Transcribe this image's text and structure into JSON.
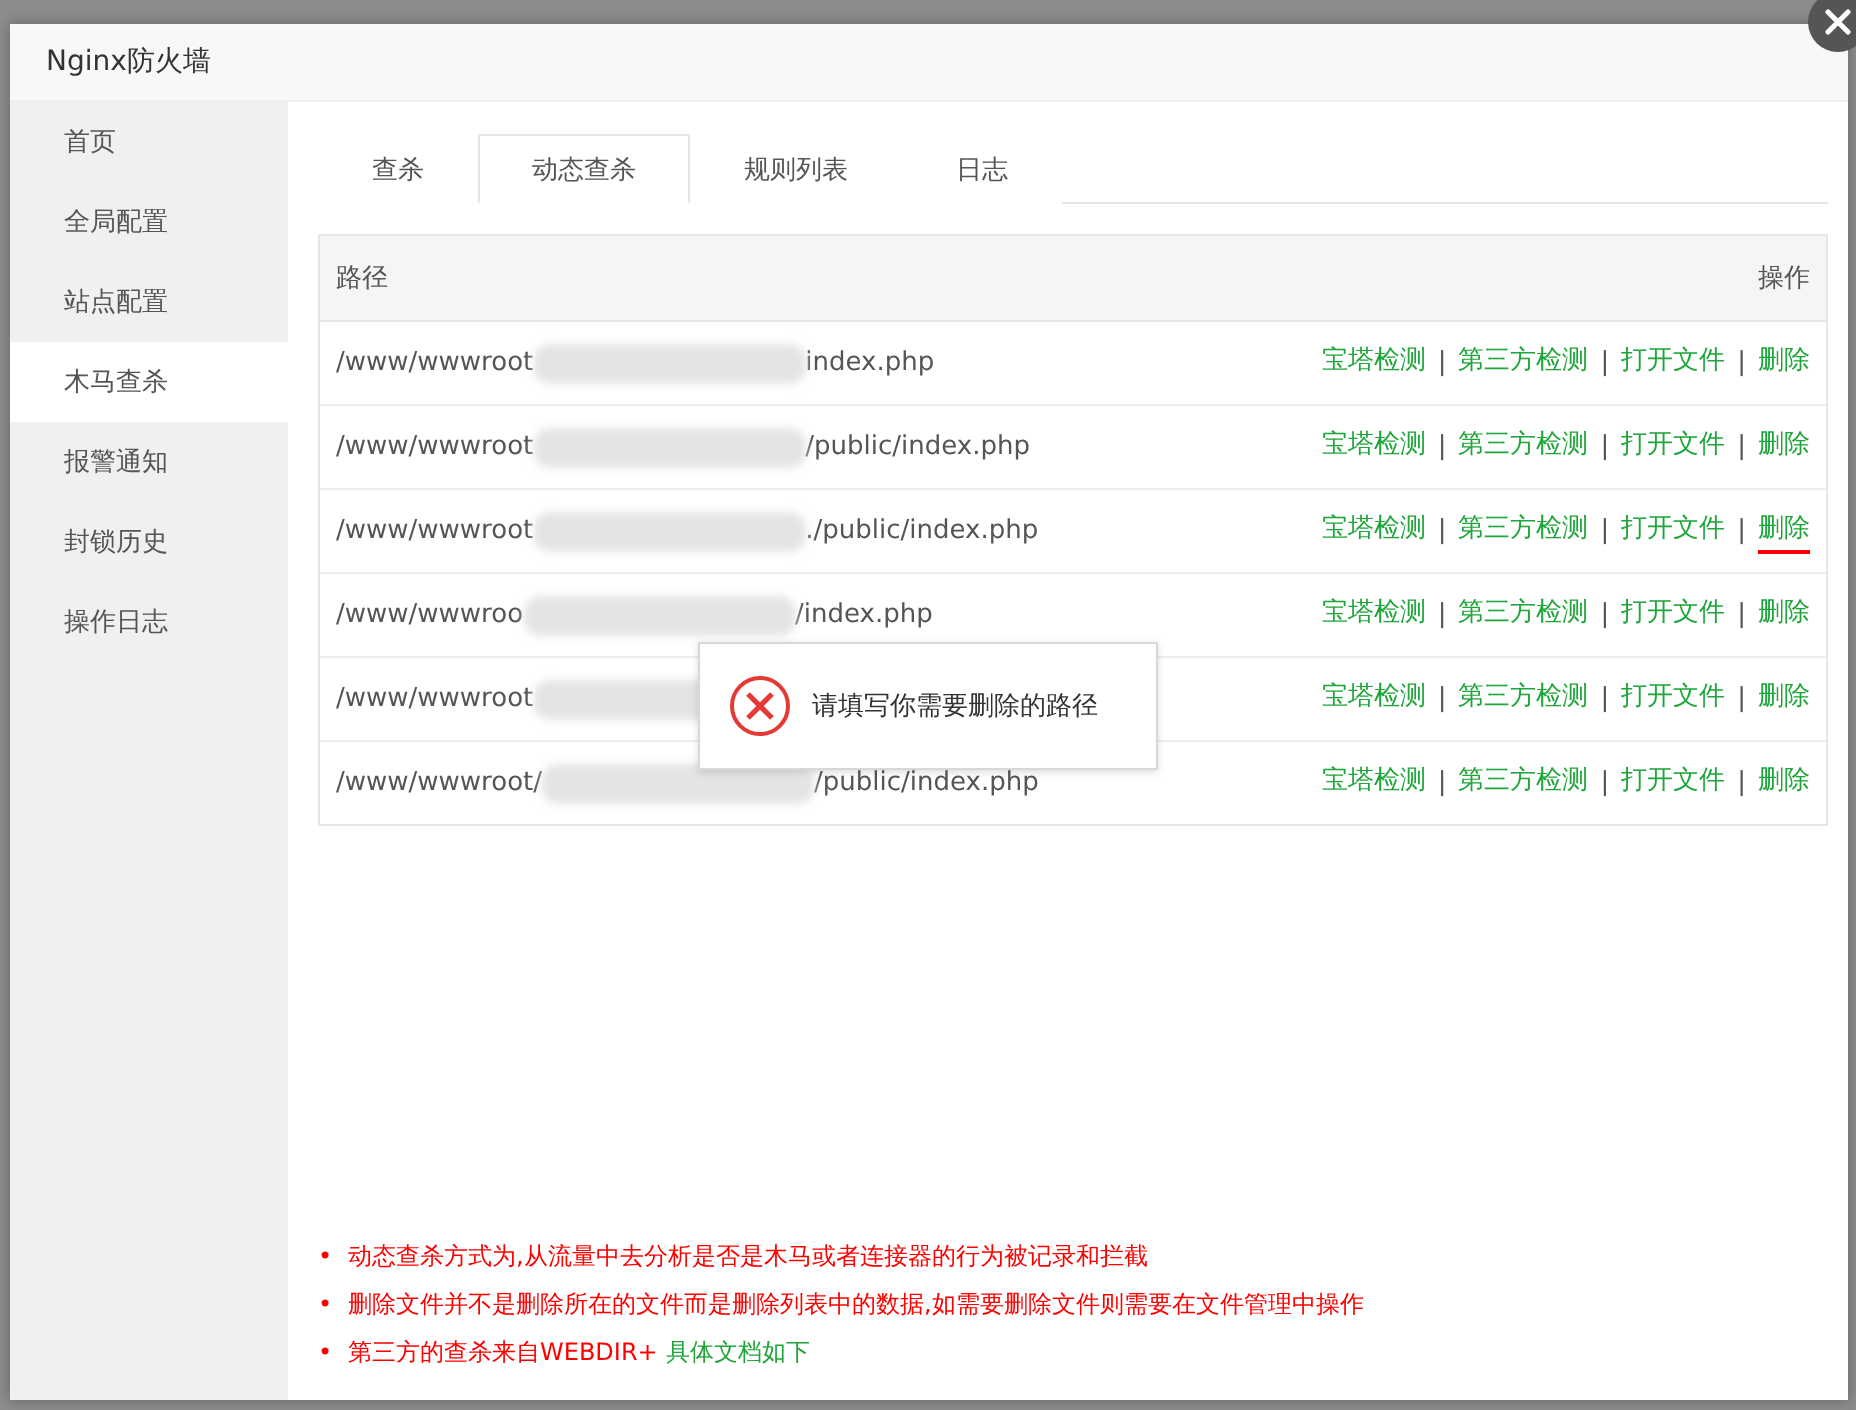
{
  "window": {
    "title": "Nginx防火墙"
  },
  "sidebar": {
    "items": [
      {
        "label": "首页",
        "selected": false
      },
      {
        "label": "全局配置",
        "selected": false
      },
      {
        "label": "站点配置",
        "selected": false
      },
      {
        "label": "木马查杀",
        "selected": true
      },
      {
        "label": "报警通知",
        "selected": false
      },
      {
        "label": "封锁历史",
        "selected": false
      },
      {
        "label": "操作日志",
        "selected": false
      }
    ]
  },
  "tabs": [
    {
      "label": "查杀",
      "selected": false
    },
    {
      "label": "动态查杀",
      "selected": true
    },
    {
      "label": "规则列表",
      "selected": false
    },
    {
      "label": "日志",
      "selected": false
    }
  ],
  "table": {
    "columns": [
      "路径",
      "操作"
    ],
    "rows": [
      {
        "path_start": "/www/wwwroot",
        "path_end": "index.php",
        "actions": [
          {
            "label": "宝塔检测",
            "underlined": false
          },
          {
            "label": "第三方检测",
            "underlined": false
          },
          {
            "label": "打开文件",
            "underlined": false
          },
          {
            "label": "删除",
            "underlined": false
          }
        ],
        "separators": [
          "|",
          "|",
          "|"
        ]
      },
      {
        "path_start": "/www/wwwroot",
        "path_end": "/public/index.php",
        "actions": [
          {
            "label": "宝塔检测",
            "underlined": false
          },
          {
            "label": "第三方检测",
            "underlined": false
          },
          {
            "label": "打开文件",
            "underlined": false
          },
          {
            "label": "删除",
            "underlined": false
          }
        ],
        "separators": [
          "|",
          "|",
          "|"
        ]
      },
      {
        "path_start": "/www/wwwroot",
        "path_end": "./public/index.php",
        "actions": [
          {
            "label": "宝塔检测",
            "underlined": false
          },
          {
            "label": "第三方检测",
            "underlined": false
          },
          {
            "label": "打开文件",
            "underlined": false
          },
          {
            "label": "删除",
            "underlined": true
          }
        ],
        "separators": [
          "|",
          "|",
          "|"
        ]
      },
      {
        "path_start": "/www/wwwroo",
        "path_end": "/index.php",
        "actions": [
          {
            "label": "宝塔检测",
            "underlined": false
          },
          {
            "label": "第三方检测",
            "underlined": false
          },
          {
            "label": "打开文件",
            "underlined": false
          },
          {
            "label": "删除",
            "underlined": false
          }
        ],
        "separators": [
          "|",
          "|",
          "|"
        ]
      },
      {
        "path_start": "/www/wwwroot",
        "actions": [
          {
            "label": "宝塔检测",
            "underlined": false
          },
          {
            "label": "第三方检测",
            "underlined": false
          },
          {
            "label": "打开文件",
            "underlined": false
          },
          {
            "label": "删除",
            "underlined": false
          }
        ],
        "separators": [
          "|",
          "|",
          "|"
        ]
      },
      {
        "path_start": "/www/wwwroot/",
        "path_end": "/public/index.php",
        "actions": [
          {
            "label": "宝塔检测",
            "underlined": false
          },
          {
            "label": "第三方检测",
            "underlined": false
          },
          {
            "label": "打开文件",
            "underlined": false
          },
          {
            "label": "删除",
            "underlined": false
          }
        ],
        "separators": [
          "|",
          "|",
          "|"
        ]
      }
    ]
  },
  "toast": {
    "message": "请填写你需要删除的路径"
  },
  "notes": [
    {
      "bullet": "•",
      "text": "动态查杀方式为,从流量中去分析是否是木马或者连接器的行为被记录和拦截"
    },
    {
      "bullet": "•",
      "text": "删除文件并不是删除所在的文件而是删除列表中的数据,如需要删除文件则需要在文件管理中操作"
    },
    {
      "bullet": "•",
      "text": "第三方的查杀来自WEBDIR+",
      "link": "具体文档如下"
    }
  ]
}
